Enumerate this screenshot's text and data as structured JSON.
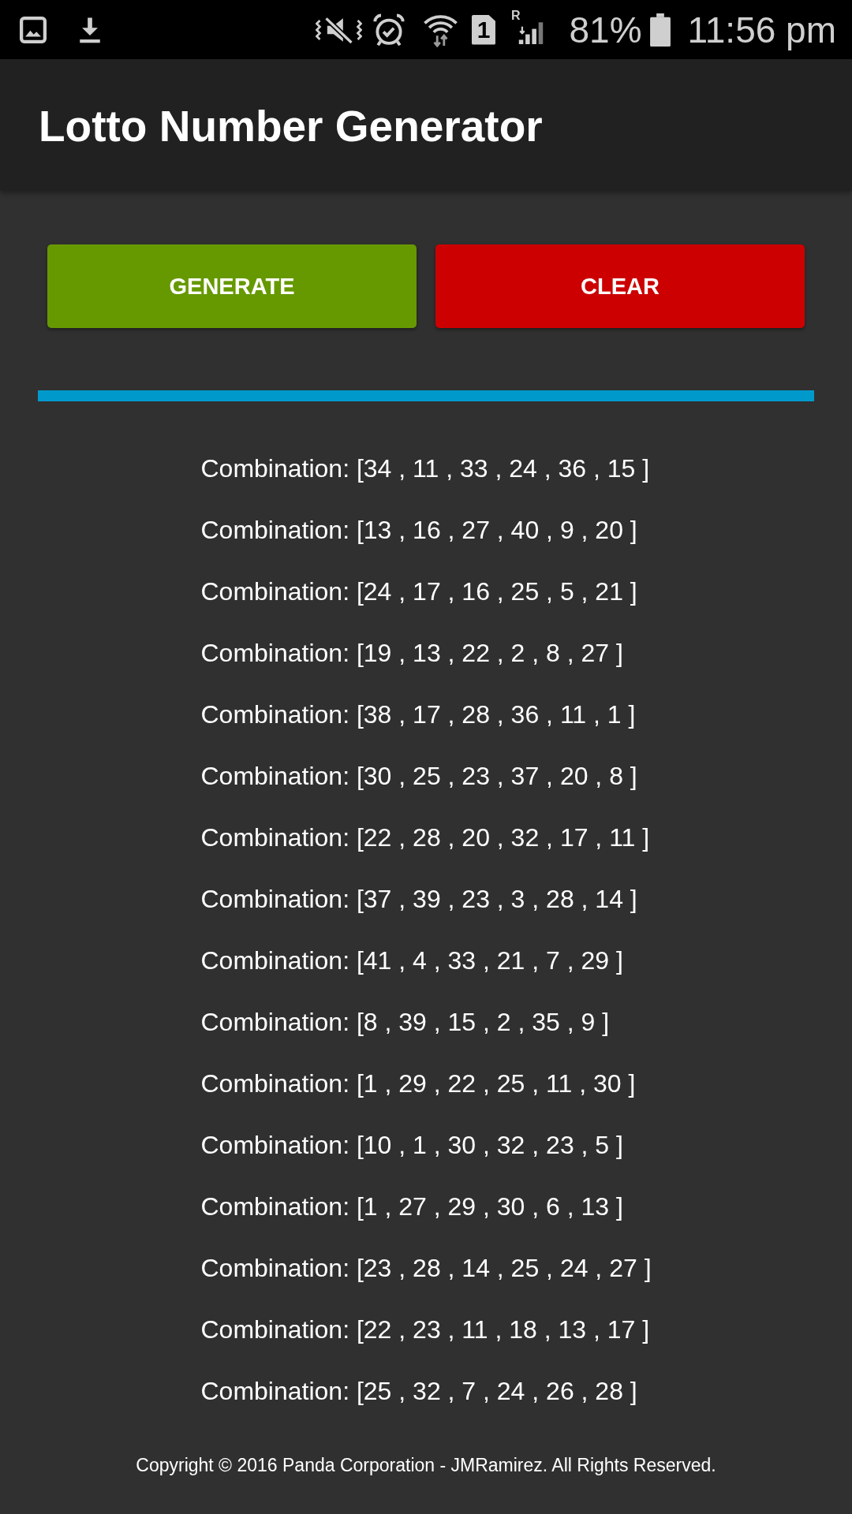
{
  "status_bar": {
    "sim_slot": "1",
    "roaming": "R",
    "battery": "81%",
    "time": "11:56 pm"
  },
  "app_bar": {
    "title": "Lotto Number Generator"
  },
  "buttons": [
    {
      "label": "GENERATE",
      "kind": "generate"
    },
    {
      "label": "CLEAR",
      "kind": "clear"
    }
  ],
  "combinations": [
    "Combination: [34 , 11 , 33 , 24 , 36 , 15 ]",
    "Combination: [13 , 16 , 27 , 40 , 9 , 20 ]",
    "Combination: [24 , 17 , 16 , 25 , 5 , 21 ]",
    "Combination: [19 , 13 , 22 , 2 , 8 , 27 ]",
    "Combination: [38 , 17 , 28 , 36 , 11 , 1 ]",
    "Combination: [30 , 25 , 23 , 37 , 20 , 8 ]",
    "Combination: [22 , 28 , 20 , 32 , 17 , 11 ]",
    "Combination: [37 , 39 , 23 , 3 , 28 , 14 ]",
    "Combination: [41 , 4 , 33 , 21 , 7 , 29 ]",
    "Combination: [8 , 39 , 15 , 2 , 35 , 9 ]",
    "Combination: [1 , 29 , 22 , 25 , 11 , 30 ]",
    "Combination: [10 , 1 , 30 , 32 , 23 , 5 ]",
    "Combination: [1 , 27 , 29 , 30 , 6 , 13 ]",
    "Combination: [23 , 28 , 14 , 25 , 24 , 27 ]",
    "Combination: [22 , 23 , 11 , 18 , 13 , 17 ]",
    "Combination: [25 , 32 , 7 , 24 , 26 , 28 ]"
  ],
  "footer": "Copyright © 2016 Panda Corporation - JMRamirez. All Rights Reserved."
}
